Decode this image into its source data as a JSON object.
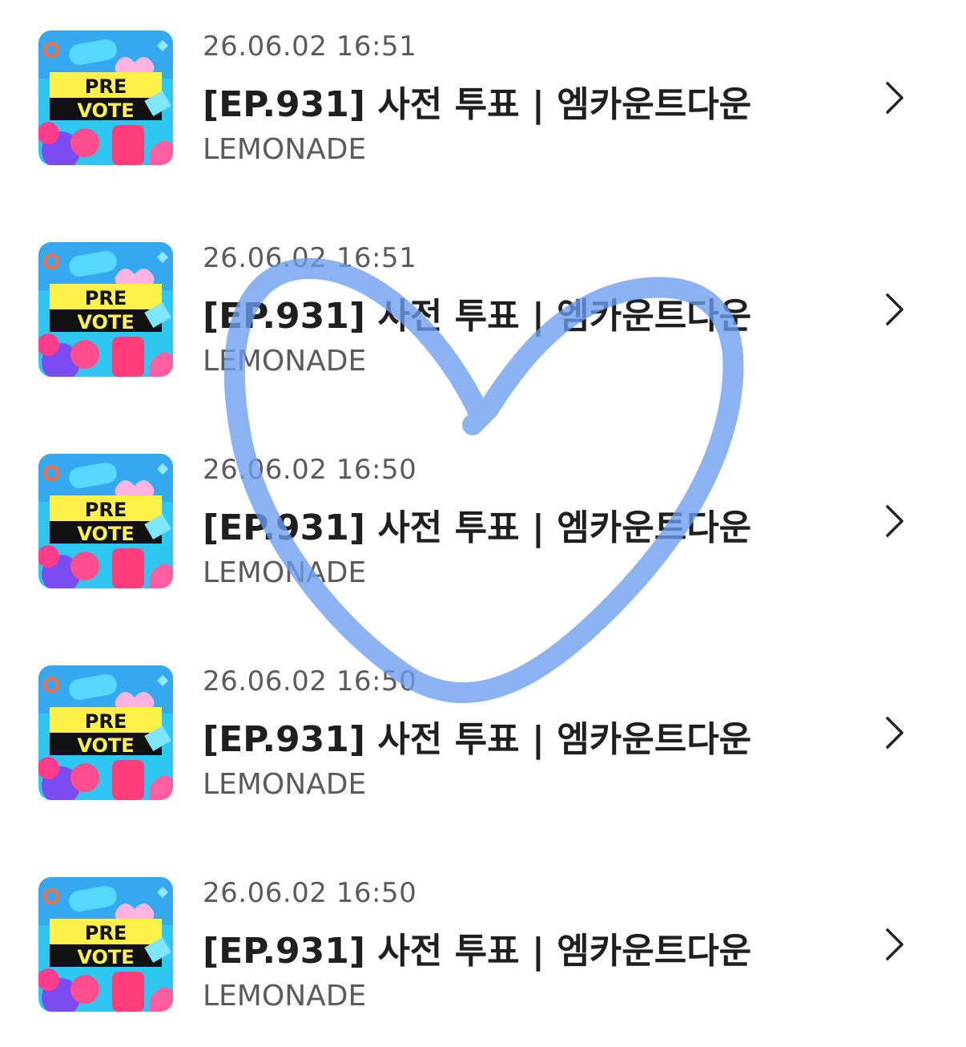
{
  "items": [
    {
      "time": "26.06.02 16:51",
      "title": "[EP.931] 사전 투표 | 엠카운트다운",
      "channel": "LEMONADE",
      "thumb_line1": "PRE",
      "thumb_line2": "VOTE"
    },
    {
      "time": "26.06.02 16:51",
      "title": "[EP.931] 사전 투표 | 엠카운트다운",
      "channel": "LEMONADE",
      "thumb_line1": "PRE",
      "thumb_line2": "VOTE"
    },
    {
      "time": "26.06.02 16:50",
      "title": "[EP.931] 사전 투표 | 엠카운트다운",
      "channel": "LEMONADE",
      "thumb_line1": "PRE",
      "thumb_line2": "VOTE"
    },
    {
      "time": "26.06.02 16:50",
      "title": "[EP.931] 사전 투표 | 엠카운트다운",
      "channel": "LEMONADE",
      "thumb_line1": "PRE",
      "thumb_line2": "VOTE"
    },
    {
      "time": "26.06.02 16:50",
      "title": "[EP.931] 사전 투표 | 엠카운트다운",
      "channel": "LEMONADE",
      "thumb_line1": "PRE",
      "thumb_line2": "VOTE"
    }
  ],
  "icons": {
    "chevron": "chevron-right-icon",
    "thumbnail": "pre-vote-thumbnail"
  },
  "overlay": {
    "shape": "hand-drawn-heart",
    "color": "#6a9cf0"
  },
  "colors": {
    "time_text": "#5b5b5b",
    "title_text": "#1f1f1f",
    "channel_text": "#5b5b5b",
    "thumb_bg": "#2fc6f0",
    "thumb_banner": "#fff04a"
  }
}
